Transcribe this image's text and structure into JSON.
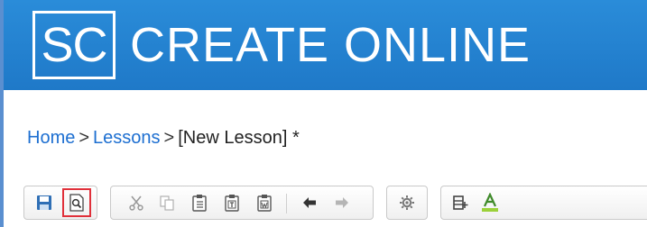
{
  "header": {
    "logo": "SC",
    "title": "CREATE ONLINE"
  },
  "breadcrumb": {
    "home": "Home",
    "sep1": ">",
    "lessons": "Lessons",
    "sep2": ">",
    "current": "[New Lesson] *"
  },
  "toolbar": {
    "highlighted_button": "preview",
    "colors": {
      "save": "#2f6fb5",
      "highlight_border": "#e0303a",
      "font_color_bar": "#9bd13a",
      "font_color_letter": "#3f8a2a"
    },
    "buttons": [
      "save",
      "preview",
      "cut",
      "copy",
      "paste",
      "paste-text",
      "paste-word",
      "undo",
      "redo",
      "settings",
      "insert-media",
      "font-color"
    ]
  }
}
